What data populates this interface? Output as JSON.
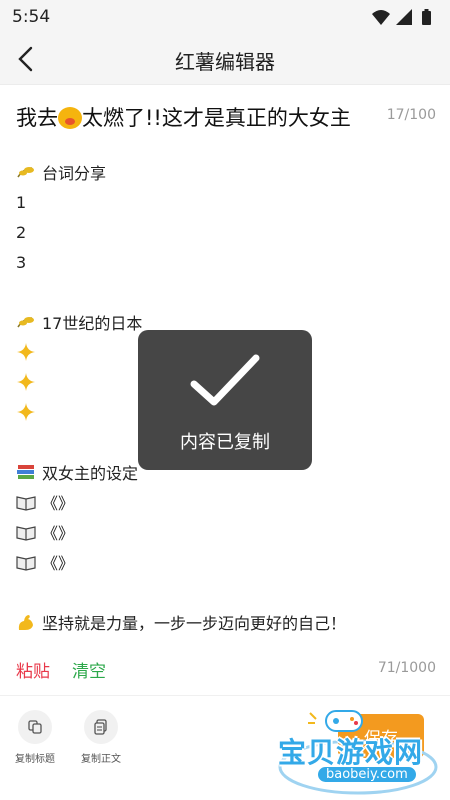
{
  "status_bar": {
    "time": "5:54",
    "icons": [
      "wifi-icon",
      "cell-signal-icon",
      "battery-icon"
    ]
  },
  "nav": {
    "title": "红薯编辑器",
    "back_icon": "back-arrow-icon"
  },
  "title_field": {
    "prefix": "我去",
    "suffix": "太燃了!!这才是真正的大女主",
    "emoji": "hot-face-emoji",
    "count": "17/100"
  },
  "body": {
    "lines": [
      {
        "icon": "rice-ear-icon",
        "text": "台词分享"
      },
      {
        "icon": "",
        "text": "1"
      },
      {
        "icon": "",
        "text": "2"
      },
      {
        "icon": "",
        "text": "3"
      },
      {
        "icon": "rice-ear-icon",
        "text": "17世纪的日本"
      },
      {
        "icon": "sparkle-icon",
        "text": ""
      },
      {
        "icon": "sparkle-icon",
        "text": ""
      },
      {
        "icon": "sparkle-icon",
        "text": ""
      },
      {
        "icon": "books-icon",
        "text": "双女主的设定"
      },
      {
        "icon": "open-book-icon",
        "text": "《》"
      },
      {
        "icon": "open-book-icon",
        "text": "《》"
      },
      {
        "icon": "open-book-icon",
        "text": "《》"
      },
      {
        "icon": "flexed-biceps-icon",
        "text": "坚持就是力量，一步一步迈向更好的自己！"
      }
    ],
    "paste_label": "粘贴",
    "clear_label": "清空",
    "count": "71/1000"
  },
  "toolbar": {
    "copy_title_label": "复制标题",
    "copy_body_label": "复制正文",
    "save_label": "保存"
  },
  "toast": {
    "text": "内容已复制"
  },
  "watermark": {
    "text": "宝贝游戏网",
    "url": "baobeiy.com"
  },
  "colors": {
    "paste": "#e8394a",
    "clear": "#2ca84a",
    "save": "#f39a1f",
    "watermark": "#33a9e8"
  }
}
